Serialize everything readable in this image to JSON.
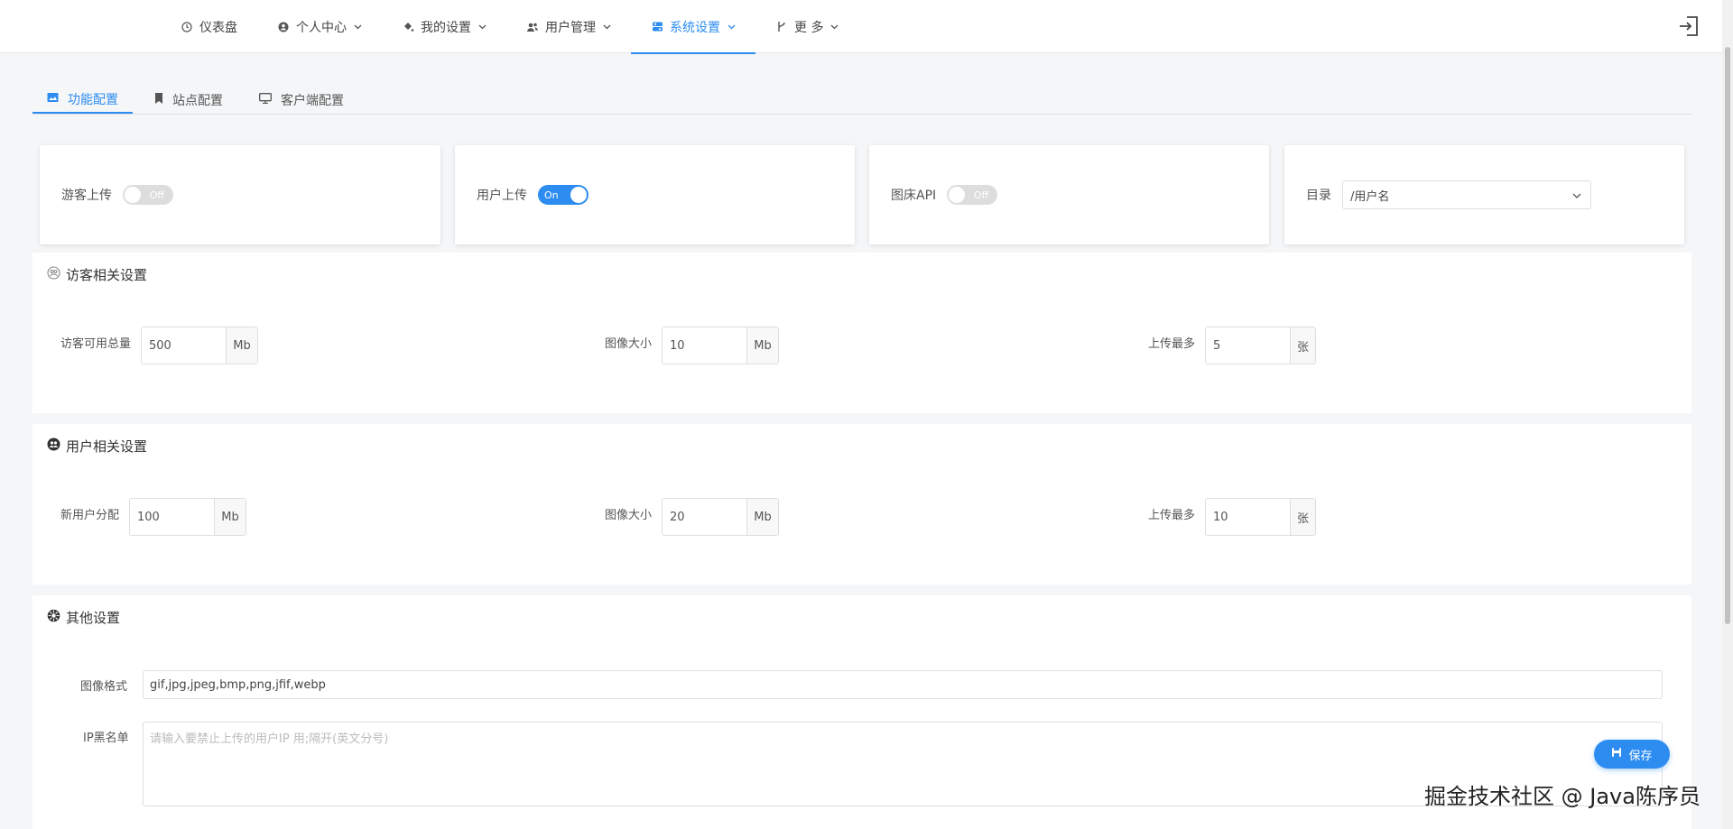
{
  "nav": {
    "items": [
      {
        "label": "仪表盘",
        "icon": "dashboard-icon",
        "has_dropdown": false
      },
      {
        "label": "个人中心",
        "icon": "user-icon",
        "has_dropdown": true
      },
      {
        "label": "我的设置",
        "icon": "paint-bucket-icon",
        "has_dropdown": true
      },
      {
        "label": "用户管理",
        "icon": "users-icon",
        "has_dropdown": true
      },
      {
        "label": "系统设置",
        "icon": "settings-icon",
        "has_dropdown": true,
        "active": true
      },
      {
        "label": "更 多",
        "icon": "branch-icon",
        "has_dropdown": true
      }
    ]
  },
  "tabs": [
    {
      "label": "功能配置",
      "active": true
    },
    {
      "label": "站点配置"
    },
    {
      "label": "客户端配置"
    }
  ],
  "cards": {
    "guest_upload": {
      "label": "游客上传",
      "state": "Off"
    },
    "user_upload": {
      "label": "用户上传",
      "state": "On"
    },
    "api": {
      "label": "图床API",
      "state": "Off"
    },
    "directory": {
      "label": "目录",
      "value": "/用户名"
    }
  },
  "guest_settings": {
    "title": "访客相关设置",
    "total_label": "访客可用总量",
    "total_value": "500",
    "total_unit": "Mb",
    "size_label": "图像大小",
    "size_value": "10",
    "size_unit": "Mb",
    "max_label": "上传最多",
    "max_value": "5",
    "max_unit": "张"
  },
  "user_settings": {
    "title": "用户相关设置",
    "alloc_label": "新用户分配",
    "alloc_value": "100",
    "alloc_unit": "Mb",
    "size_label": "图像大小",
    "size_value": "20",
    "size_unit": "Mb",
    "max_label": "上传最多",
    "max_value": "10",
    "max_unit": "张"
  },
  "other_settings": {
    "title": "其他设置",
    "format_label": "图像格式",
    "format_value": "gif,jpg,jpeg,bmp,png,jfif,webp",
    "ip_label": "IP黑名单",
    "ip_placeholder": "请输入要禁止上传的用户IP 用;隔开(英文分号)"
  },
  "save_label": "保存",
  "watermark": "掘金技术社区 @ Java陈序员",
  "colors": {
    "accent": "#2d8cf0",
    "switch_off": "#dddddd"
  }
}
